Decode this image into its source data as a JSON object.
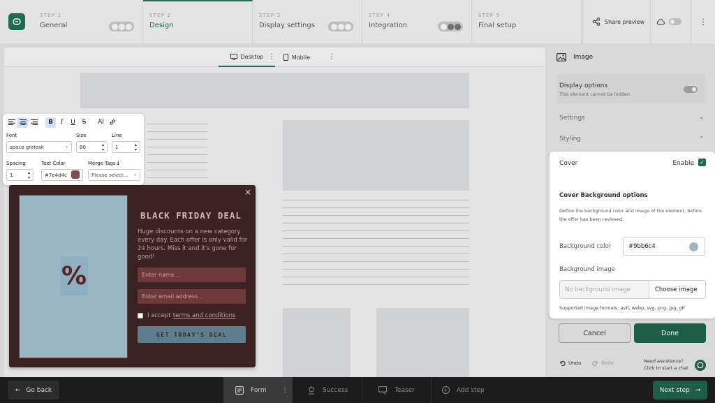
{
  "steps": [
    {
      "num": "STEP 1",
      "label": "General"
    },
    {
      "num": "STEP 2",
      "label": "Design"
    },
    {
      "num": "STEP 3",
      "label": "Display settings"
    },
    {
      "num": "STEP 4",
      "label": "Integration"
    },
    {
      "num": "STEP 5",
      "label": "Final setup"
    }
  ],
  "header": {
    "share_label": "Share preview"
  },
  "device_tabs": {
    "desktop": "Desktop",
    "mobile": "Mobile"
  },
  "toolbar": {
    "font_label": "Font",
    "font_value": "space grotesk",
    "size_label": "Size",
    "size_value": "80",
    "line_label": "Line",
    "line_value": "1",
    "spacing_label": "Spacing",
    "spacing_value": "1",
    "color_label": "Text Color",
    "color_value": "#7e4d4c",
    "merge_label": "Merge Tags",
    "merge_placeholder": "Please select...",
    "ai_label": "AI"
  },
  "popup": {
    "title": "BLACK FRIDAY DEAL",
    "body": "Huge discounts on a new category every day. Each offer is only valid for 24 hours. Miss it and it's gone for good!",
    "name_placeholder": "Enter name...",
    "email_placeholder": "Enter email address...",
    "accept_prefix": "I accept",
    "terms_link": "terms and conditions",
    "cta": "GET TODAY'S DEAL",
    "cover_glyph": "%",
    "close_glyph": "×"
  },
  "panel": {
    "title": "Image",
    "display_options": "Display options",
    "display_hint": "This element cannot be hidden",
    "settings": "Settings",
    "styling": "Styling",
    "cover": "Cover",
    "enable": "Enable",
    "bg_options_title": "Cover Background options",
    "bg_options_desc": "Define the background color and image of the element, before the offer has been revleaed.",
    "bg_color_label": "Background color",
    "bg_color_value": "#9bb6c4",
    "bg_image_label": "Background image",
    "bg_image_placeholder": "No background image",
    "choose_image": "Choose image",
    "formats": "Supported image formats: avif, webp, svg, png, jpg, gif",
    "cancel": "Cancel",
    "done": "Done",
    "undo": "Undo",
    "redo": "Redo",
    "help_title": "Need assistance?",
    "help_sub": "Click to start a chat"
  },
  "bottom": {
    "go_back": "Go back",
    "tabs": [
      "Form",
      "Success",
      "Teaser"
    ],
    "add_step": "Add step",
    "next_step": "Next step"
  },
  "colors": {
    "accent": "#1e6b50",
    "popup_bg": "#3c2223",
    "cover": "#9bb6c4",
    "text_color": "#7e4d4c"
  },
  "icons": [
    "logo-icon",
    "share-icon",
    "cloud-icon",
    "more-icon",
    "desktop-icon",
    "mobile-icon",
    "image-icon",
    "check-icon",
    "undo-icon",
    "redo-icon",
    "chat-icon",
    "arrow-left-icon",
    "arrow-right-icon",
    "form-icon",
    "success-icon",
    "teaser-icon",
    "plus-icon"
  ]
}
